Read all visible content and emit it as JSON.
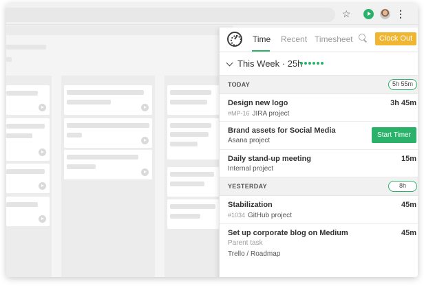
{
  "browser": {
    "icons": [
      "star-icon",
      "play-extension-icon",
      "avatar-icon",
      "kebab-menu-icon"
    ]
  },
  "popup": {
    "tabs": [
      {
        "label": "Time",
        "active": true
      },
      {
        "label": "Recent",
        "active": false
      },
      {
        "label": "Timesheet",
        "active": false
      }
    ],
    "clock_out_label": "Clock Out",
    "week": {
      "title": "This Week · 25h"
    },
    "sections": [
      {
        "label": "TODAY",
        "total": "5h 55m"
      },
      {
        "label": "YESTERDAY",
        "total": "8h"
      }
    ],
    "entries": [
      {
        "title": "Design new logo",
        "id": "#MP-16",
        "project": "JIRA project",
        "duration": "3h 45m"
      },
      {
        "title": "Brand assets for Social Media",
        "project": "Asana project",
        "button": "Start Timer"
      },
      {
        "title": "Daily stand-up meeting",
        "project": "Internal project",
        "duration": "15m"
      },
      {
        "title": "Stabilization",
        "id": "#1034",
        "project": "GitHub project",
        "duration": "45m"
      },
      {
        "title": "Set up corporate blog on Medium",
        "parent": "Parent task",
        "project": "Trello / Roadmap",
        "duration": "45m"
      }
    ]
  },
  "colors": {
    "accent_green": "#2ab26a",
    "clock_out_yellow": "#f0b632"
  }
}
